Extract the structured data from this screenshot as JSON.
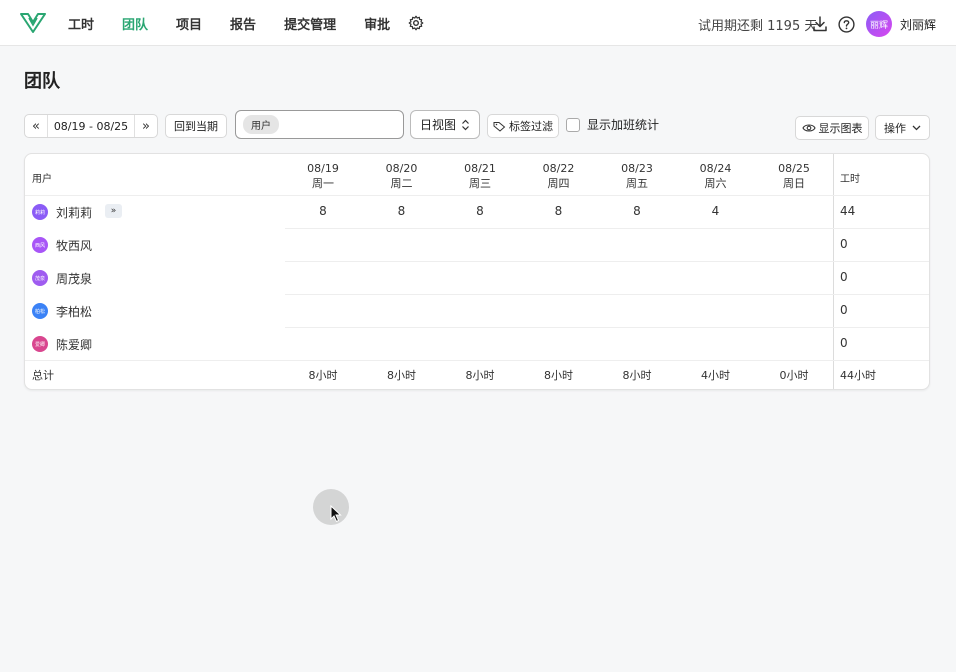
{
  "nav": {
    "items": [
      {
        "label": "工时",
        "active": false
      },
      {
        "label": "团队",
        "active": true
      },
      {
        "label": "项目",
        "active": false
      },
      {
        "label": "报告",
        "active": false
      },
      {
        "label": "提交管理",
        "active": false
      },
      {
        "label": "审批",
        "active": false
      }
    ],
    "trial_text": "试用期还剩 1195 天",
    "avatar_text": "丽辉",
    "user_name": "刘丽辉",
    "accent_color": "#2aa672"
  },
  "page": {
    "title": "团队"
  },
  "toolbar": {
    "date_range": "08/19 - 08/25",
    "back_label": "回到当期",
    "user_chip": "用户",
    "view_label": "日视图",
    "tag_filter_label": "标签过滤",
    "overtime_label": "显示加班统计",
    "show_chart_label": "显示图表",
    "ops_label": "操作"
  },
  "table": {
    "user_header": "用户",
    "hours_header": "工时",
    "days": [
      {
        "date": "08/19",
        "weekday": "周一"
      },
      {
        "date": "08/20",
        "weekday": "周二"
      },
      {
        "date": "08/21",
        "weekday": "周三"
      },
      {
        "date": "08/22",
        "weekday": "周四"
      },
      {
        "date": "08/23",
        "weekday": "周五"
      },
      {
        "date": "08/24",
        "weekday": "周六"
      },
      {
        "date": "08/25",
        "weekday": "周日"
      }
    ],
    "rows": [
      {
        "name": "刘莉莉",
        "avatar": "莉莉",
        "color": "#8b5cf6",
        "cells": [
          "8",
          "8",
          "8",
          "8",
          "8",
          "4",
          ""
        ],
        "total": "44",
        "expand": "»"
      },
      {
        "name": "牧西风",
        "avatar": "西风",
        "color": "#a855f7",
        "cells": [
          "",
          "",
          "",
          "",
          "",
          "",
          ""
        ],
        "total": "0"
      },
      {
        "name": "周茂泉",
        "avatar": "茂泉",
        "color": "#9f5cf0",
        "cells": [
          "",
          "",
          "",
          "",
          "",
          "",
          ""
        ],
        "total": "0"
      },
      {
        "name": "李柏松",
        "avatar": "柏松",
        "color": "#3b82f6",
        "cells": [
          "",
          "",
          "",
          "",
          "",
          "",
          ""
        ],
        "total": "0"
      },
      {
        "name": "陈爱卿",
        "avatar": "爱卿",
        "color": "#d9468f",
        "cells": [
          "",
          "",
          "",
          "",
          "",
          "",
          ""
        ],
        "total": "0"
      }
    ],
    "summary_label": "总计",
    "summary": [
      "8小时",
      "8小时",
      "8小时",
      "8小时",
      "8小时",
      "4小时",
      "0小时"
    ],
    "summary_total": "44小时"
  }
}
